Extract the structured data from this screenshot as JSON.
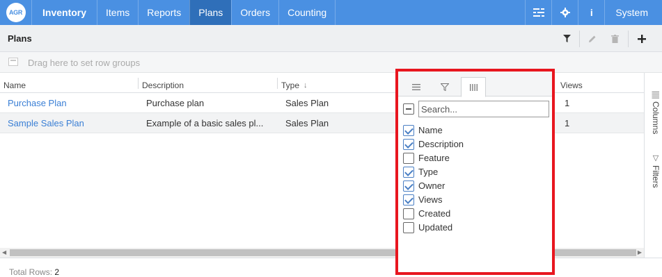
{
  "nav": {
    "logo": "AGR",
    "brand": "Inventory",
    "items": [
      "Items",
      "Reports",
      "Plans",
      "Orders",
      "Counting"
    ],
    "active": "Plans",
    "info_glyph": "i",
    "system": "System",
    "accent": "#4a90e2"
  },
  "page": {
    "title": "Plans",
    "row_group_hint": "Drag here to set row groups"
  },
  "grid": {
    "columns": [
      "Name",
      "Description",
      "Type",
      "Views"
    ],
    "rows": [
      {
        "name": "Purchase Plan",
        "description": "Purchase plan",
        "type": "Sales Plan",
        "views": "1"
      },
      {
        "name": "Sample Sales Plan",
        "description": "Example of a basic sales pl...",
        "type": "Sales Plan",
        "views": "1"
      }
    ]
  },
  "footer": {
    "total_label": "Total Rows:",
    "total_value": "2"
  },
  "sidebar": {
    "columns_label": "Columns",
    "filters_label": "Filters"
  },
  "tool_panel": {
    "search_placeholder": "Search...",
    "columns": [
      {
        "label": "Name",
        "checked": true
      },
      {
        "label": "Description",
        "checked": true
      },
      {
        "label": "Feature",
        "checked": false
      },
      {
        "label": "Type",
        "checked": true
      },
      {
        "label": "Owner",
        "checked": true
      },
      {
        "label": "Views",
        "checked": true
      },
      {
        "label": "Created",
        "checked": false
      },
      {
        "label": "Updated",
        "checked": false
      }
    ],
    "highlight_color": "#e8161f"
  }
}
